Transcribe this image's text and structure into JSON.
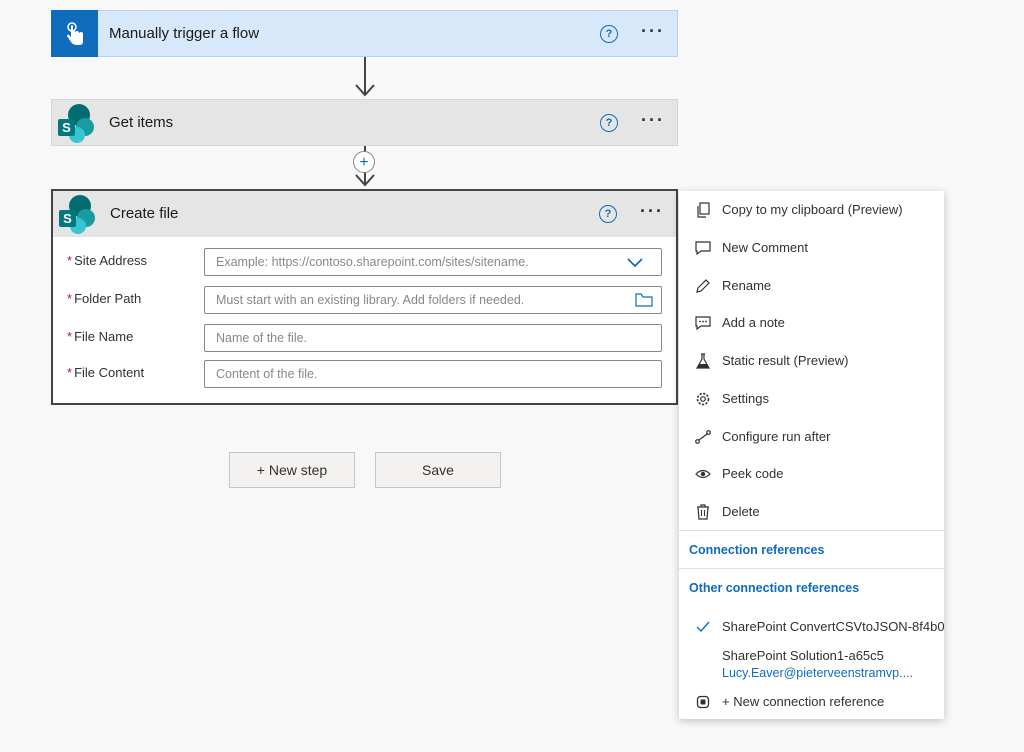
{
  "steps": {
    "trigger": {
      "title": "Manually trigger a flow",
      "help": "?",
      "more": "···"
    },
    "get_items": {
      "title": "Get items",
      "help": "?",
      "more": "···"
    },
    "create_file": {
      "title": "Create file",
      "help": "?",
      "more": "···",
      "fields": [
        {
          "label": "Site Address",
          "required": "*",
          "placeholder": "Example: https://contoso.sharepoint.com/sites/sitename."
        },
        {
          "label": "Folder Path",
          "required": "*",
          "placeholder": "Must start with an existing library. Add folders if needed."
        },
        {
          "label": "File Name",
          "required": "*",
          "placeholder": "Name of the file."
        },
        {
          "label": "File Content",
          "required": "*",
          "placeholder": "Content of the file."
        }
      ]
    }
  },
  "insert_step": "+",
  "actions": {
    "new_step": "+ New step",
    "save": "Save"
  },
  "menu": {
    "items": [
      {
        "label": "Copy to my clipboard (Preview)",
        "icon": "copy-icon"
      },
      {
        "label": "New Comment",
        "icon": "comment-icon"
      },
      {
        "label": "Rename",
        "icon": "pencil-icon"
      },
      {
        "label": "Add a note",
        "icon": "note-icon"
      },
      {
        "label": "Static result (Preview)",
        "icon": "beaker-icon"
      },
      {
        "label": "Settings",
        "icon": "gear-icon"
      },
      {
        "label": "Configure run after",
        "icon": "run-after-icon"
      },
      {
        "label": "Peek code",
        "icon": "eye-icon"
      },
      {
        "label": "Delete",
        "icon": "trash-icon"
      }
    ],
    "connection_references": "Connection references",
    "other_connection_references": "Other connection references",
    "connections": [
      {
        "name": "SharePoint ConvertCSVtoJSON-8f4b0",
        "selected": true
      },
      {
        "name": "SharePoint Solution1-a65c5",
        "account": "Lucy.Eaver@pieterveenstramvp...."
      }
    ],
    "new_connection": "+ New connection reference"
  },
  "colors": {
    "accent": "#0f6cbd",
    "trigger_bg": "#d7e8fb",
    "sharepoint": "#038387"
  }
}
